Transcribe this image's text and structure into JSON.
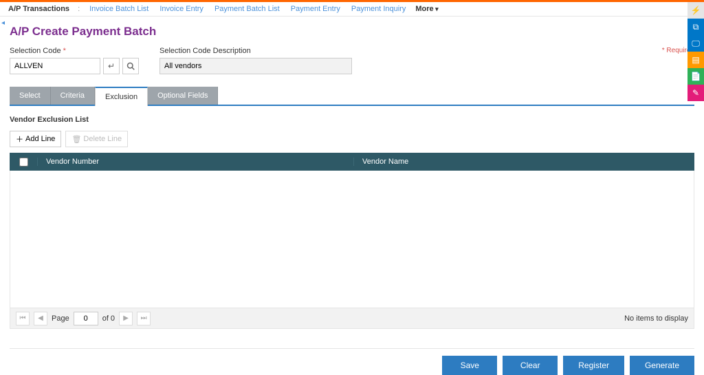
{
  "nav": {
    "context": "A/P Transactions",
    "links": [
      "Invoice Batch List",
      "Invoice Entry",
      "Payment Batch List",
      "Payment Entry",
      "Payment Inquiry"
    ],
    "more": "More"
  },
  "page": {
    "title": "A/P Create Payment Batch",
    "required_text": "Required"
  },
  "form": {
    "selection_code": {
      "label": "Selection Code",
      "value": "ALLVEN"
    },
    "selection_desc": {
      "label": "Selection Code Description",
      "value": "All vendors"
    }
  },
  "tabs": [
    "Select",
    "Criteria",
    "Exclusion",
    "Optional Fields"
  ],
  "active_tab": "Exclusion",
  "section": {
    "title": "Vendor Exclusion List"
  },
  "grid_actions": {
    "add": "Add Line",
    "delete": "Delete Line"
  },
  "grid": {
    "columns": [
      "Vendor Number",
      "Vendor Name"
    ],
    "pager": {
      "page_label": "Page",
      "page": "0",
      "of_label": "of 0"
    },
    "empty": "No items to display"
  },
  "footer_buttons": [
    "Save",
    "Clear",
    "Register",
    "Generate"
  ],
  "side_rail_colors": [
    "#e5e5e5",
    "#0077c8",
    "#0077c8",
    "#ff9900",
    "#2fb158",
    "#e31c79"
  ]
}
